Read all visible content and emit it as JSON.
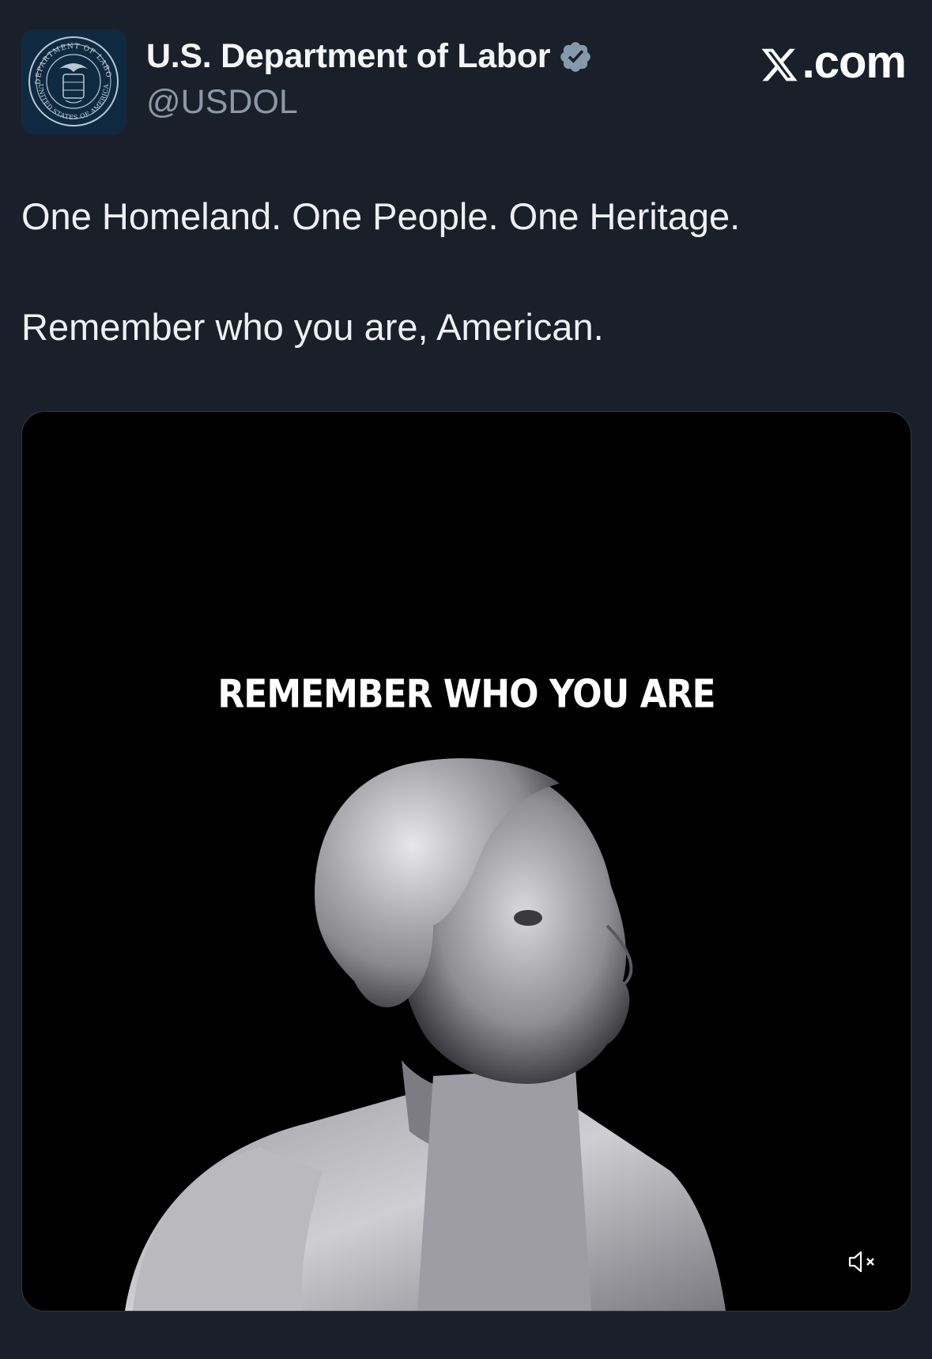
{
  "account": {
    "display_name": "U.S. Department of Labor",
    "handle": "@USDOL",
    "verified_icon": "verified-badge-icon",
    "avatar_seal_top": "DEPARTMENT OF LABOR",
    "avatar_seal_bottom": "UNITED STATES OF AMERICA"
  },
  "brand": {
    "label": ".com",
    "icon": "x-logo-icon"
  },
  "post": {
    "line1": "One Homeland. One People. One Heritage.",
    "line2": "Remember who you are, American."
  },
  "media": {
    "caption": "REMEMBER WHO YOU ARE",
    "mute_icon": "speaker-muted-icon"
  },
  "colors": {
    "background": "#19202a",
    "verified": "#829aab",
    "handle": "#8b98a5",
    "text": "#e7e9ea"
  }
}
